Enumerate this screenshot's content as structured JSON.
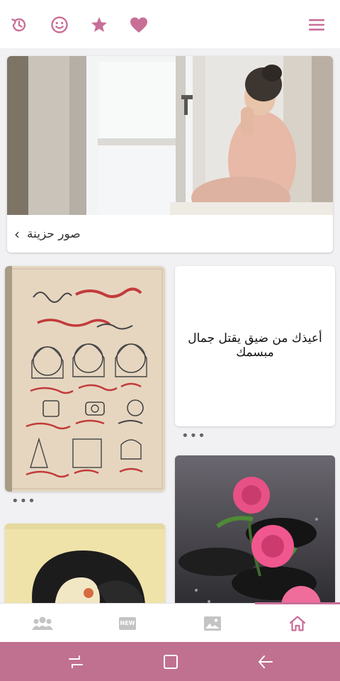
{
  "colors": {
    "accent": "#c86f98",
    "system_bar": "#c0718f",
    "nav_inactive": "#c4c4c4",
    "background": "#f1f1f3"
  },
  "topbar": {
    "icons": [
      "history-icon",
      "smiley-icon",
      "star-icon",
      "heart-icon",
      "menu-icon"
    ]
  },
  "hero": {
    "title": "صور حزينة",
    "chevron": "‹"
  },
  "cards": {
    "quote": "أعيذك من ضيق يقتل جمال مبسمك",
    "more": "•••"
  },
  "bottom_nav": {
    "items": [
      "people-icon",
      "new-badge-icon",
      "gallery-icon",
      "home-icon"
    ],
    "new_label": "NEW",
    "active": "home-icon"
  },
  "system_nav": {
    "items": [
      "recents-icon",
      "home-square-icon",
      "back-icon"
    ]
  }
}
